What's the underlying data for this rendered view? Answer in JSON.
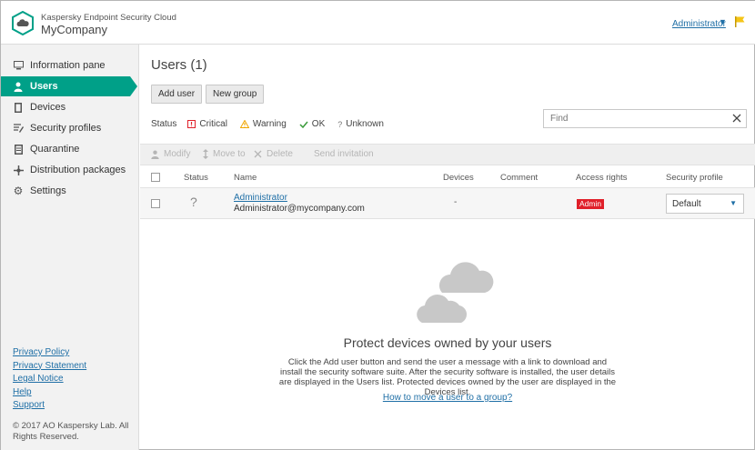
{
  "header": {
    "product_name": "Kaspersky Endpoint Security Cloud",
    "company": "MyCompany",
    "user_menu": "Administrator"
  },
  "colors": {
    "accent": "#00a088",
    "link": "#1f6fa6",
    "critical": "#e0202a",
    "warning": "#f0a500",
    "ok": "#3a9a3a",
    "flag": "#f5c518"
  },
  "sidebar": {
    "items": [
      {
        "label": "Information pane",
        "icon": "monitor-icon",
        "active": false
      },
      {
        "label": "Users",
        "icon": "user-icon",
        "active": true
      },
      {
        "label": "Devices",
        "icon": "device-icon",
        "active": false
      },
      {
        "label": "Security profiles",
        "icon": "profile-icon",
        "active": false
      },
      {
        "label": "Quarantine",
        "icon": "quarantine-icon",
        "active": false
      },
      {
        "label": "Distribution packages",
        "icon": "package-icon",
        "active": false
      },
      {
        "label": "Settings",
        "icon": "gear-icon",
        "active": false
      }
    ],
    "links": [
      "Privacy Policy",
      "Privacy Statement",
      "Legal Notice",
      "Help",
      "Support"
    ],
    "copyright": "© 2017 AO Kaspersky Lab. All Rights Reserved."
  },
  "main": {
    "title": "Users (1)",
    "buttons": {
      "add_user": "Add user",
      "new_group": "New group"
    },
    "status_filter": {
      "label": "Status",
      "critical": "Critical",
      "warning": "Warning",
      "ok": "OK",
      "unknown": "Unknown"
    },
    "search": {
      "placeholder": "Find"
    },
    "toolbar": {
      "modify": "Modify",
      "move_to": "Move to",
      "delete": "Delete",
      "send_invitation": "Send invitation"
    },
    "table": {
      "columns": [
        "Status",
        "Name",
        "Devices",
        "Comment",
        "Access rights",
        "Security profile"
      ],
      "rows": [
        {
          "status": "?",
          "name": "Administrator",
          "email": "Administrator@mycompany.com",
          "devices": "-",
          "comment": "",
          "access_rights": "Admin",
          "security_profile": "Default"
        }
      ]
    },
    "empty_state": {
      "title": "Protect devices owned by your users",
      "description": "Click the Add user button and send the user a message with a link to download and install the security software suite. After the security software is installed, the user details are displayed in the Users list. Protected devices owned by the user are displayed in the Devices list.",
      "link": "How to move a user to a group?"
    }
  }
}
